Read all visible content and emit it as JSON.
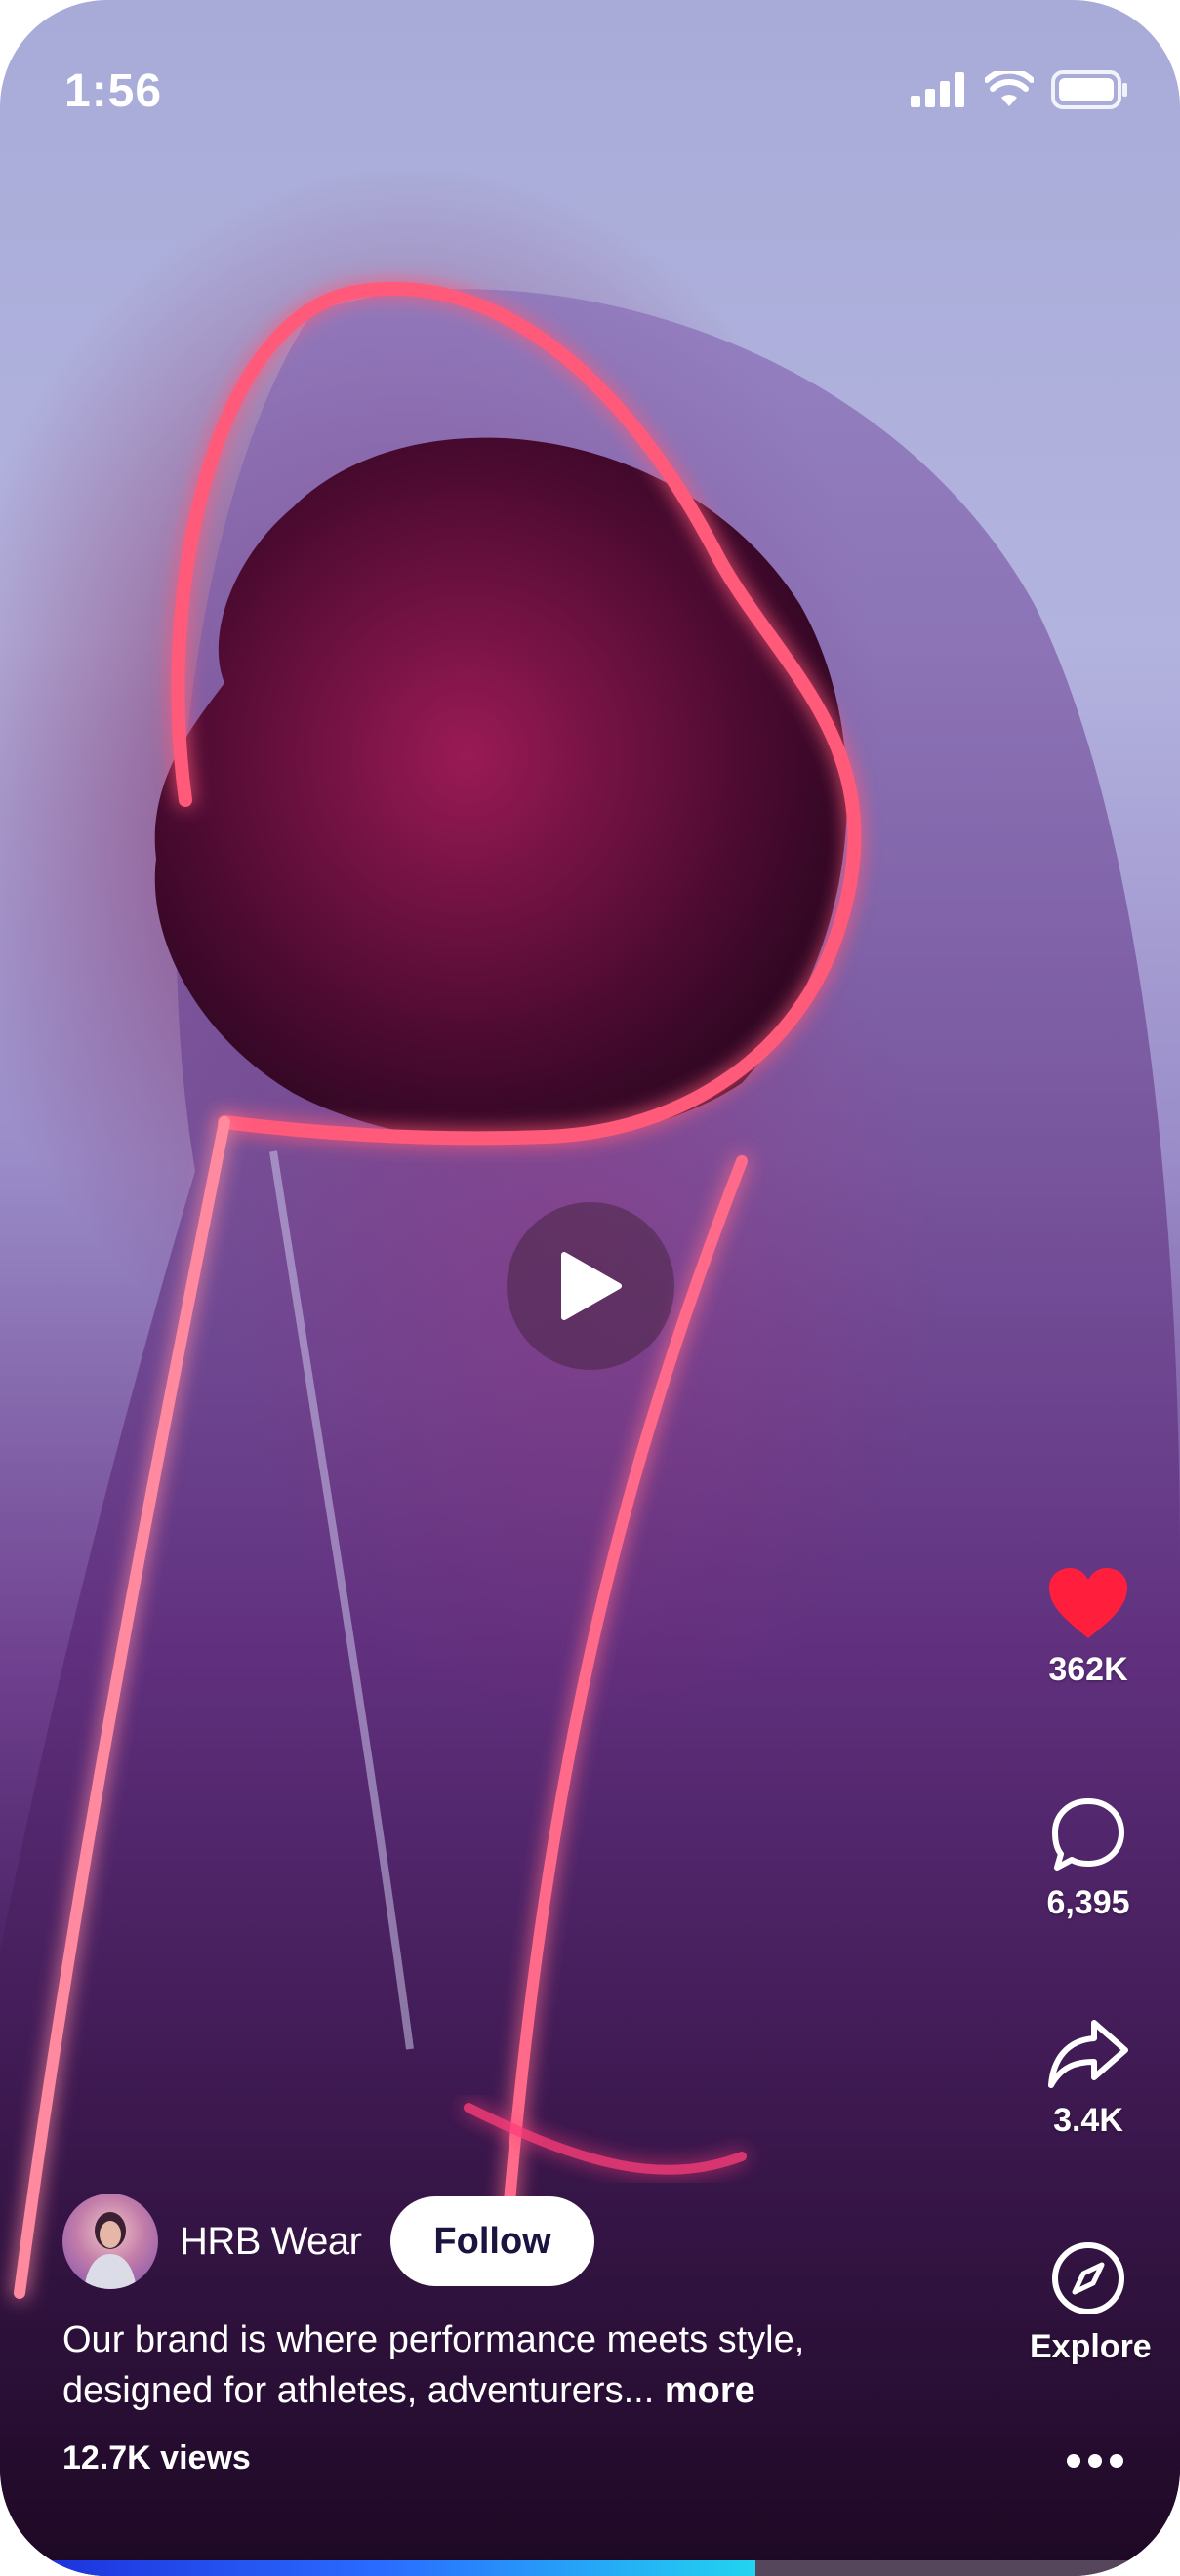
{
  "status_bar": {
    "time": "1:56",
    "icons": [
      "signal-icon",
      "wifi-icon",
      "battery-icon"
    ]
  },
  "video": {
    "play_icon": "play-icon",
    "progress": 0.64
  },
  "actions": {
    "like": {
      "icon": "heart-icon",
      "count": "362K",
      "color": "#ff1f3d"
    },
    "comment": {
      "icon": "comment-icon",
      "count": "6,395"
    },
    "share": {
      "icon": "share-icon",
      "count": "3.4K"
    },
    "explore": {
      "icon": "compass-icon",
      "label": "Explore"
    },
    "more": {
      "icon": "more-dots-icon"
    }
  },
  "post": {
    "account_name": "HRB Wear",
    "follow_label": "Follow",
    "caption": "Our brand is where performance meets style, designed for athletes, adventurers...",
    "more_label": "more",
    "views": "12.7K views"
  },
  "colors": {
    "accent_like": "#ff1f3d",
    "progress_start": "#1b2bd8",
    "progress_end": "#22d4f0"
  }
}
